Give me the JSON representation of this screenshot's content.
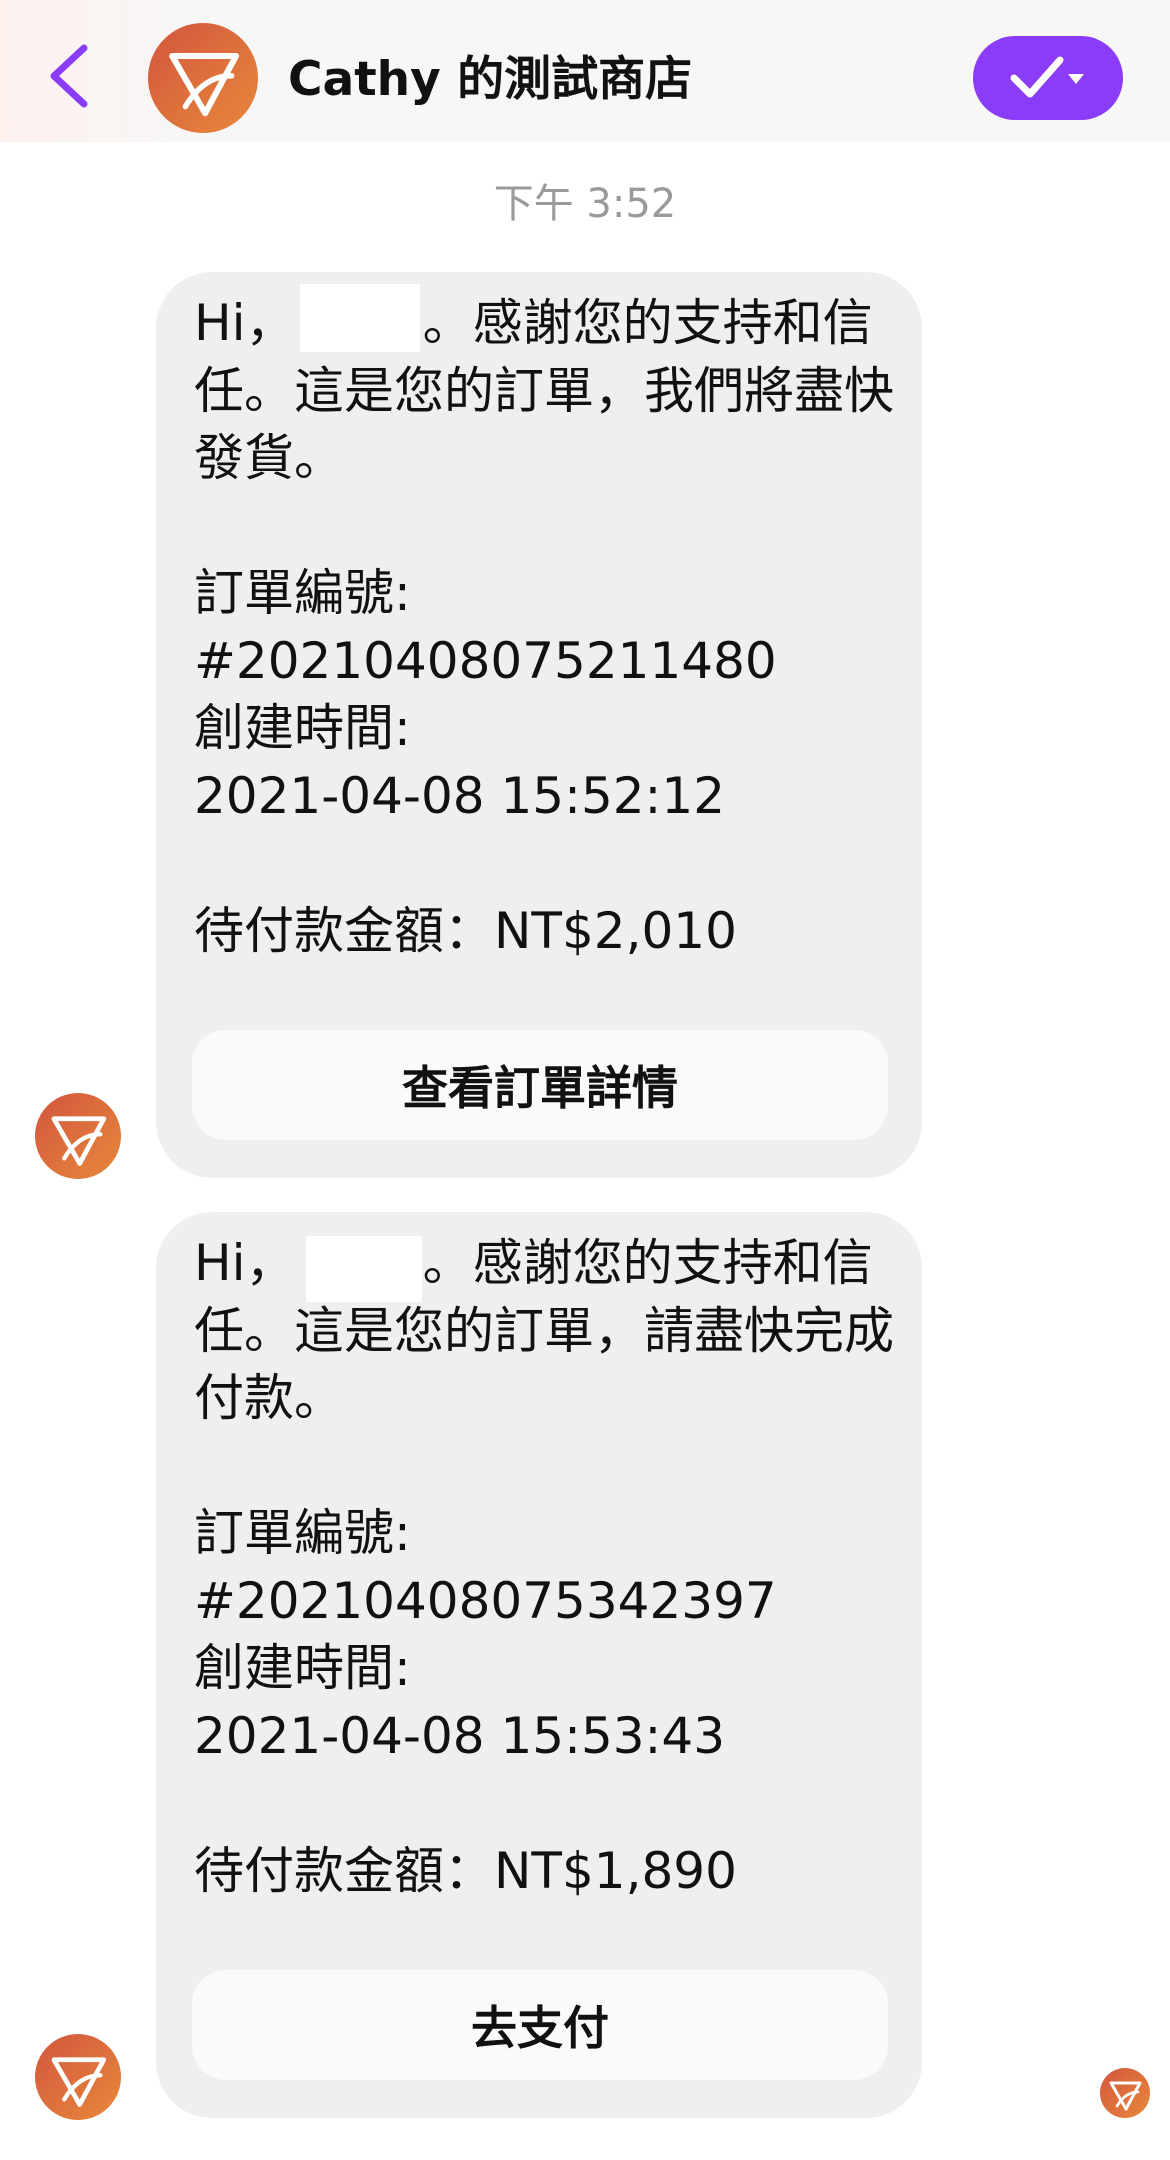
{
  "header": {
    "back_icon": "chevron-left-icon",
    "shop_name": "Cathy 的測試商店",
    "status_icon": "check-with-dropdown-icon",
    "accent_color": "#8b3cf7"
  },
  "timestamp": "下午 3:52",
  "messages": [
    {
      "text": "Hi，        。感謝您的支持和信任。這是您的訂單，我們將盡快發貨。\n\n訂單編號:\n#20210408075211480\n創建時間:\n2021-04-08 15:52:12\n\n待付款金額：NT$2,010",
      "button_label": "查看訂單詳情"
    },
    {
      "text": "Hi，        。感謝您的支持和信任。這是您的訂單，請盡快完成付款。\n\n訂單編號:\n#20210408075342397\n創建時間:\n2021-04-08 15:53:43\n\n待付款金額：NT$1,890",
      "button_label": "去支付"
    }
  ],
  "colors": {
    "bubble_bg": "#efefef",
    "avatar_gradient_start": "#d2553f",
    "avatar_gradient_end": "#e8893a"
  }
}
